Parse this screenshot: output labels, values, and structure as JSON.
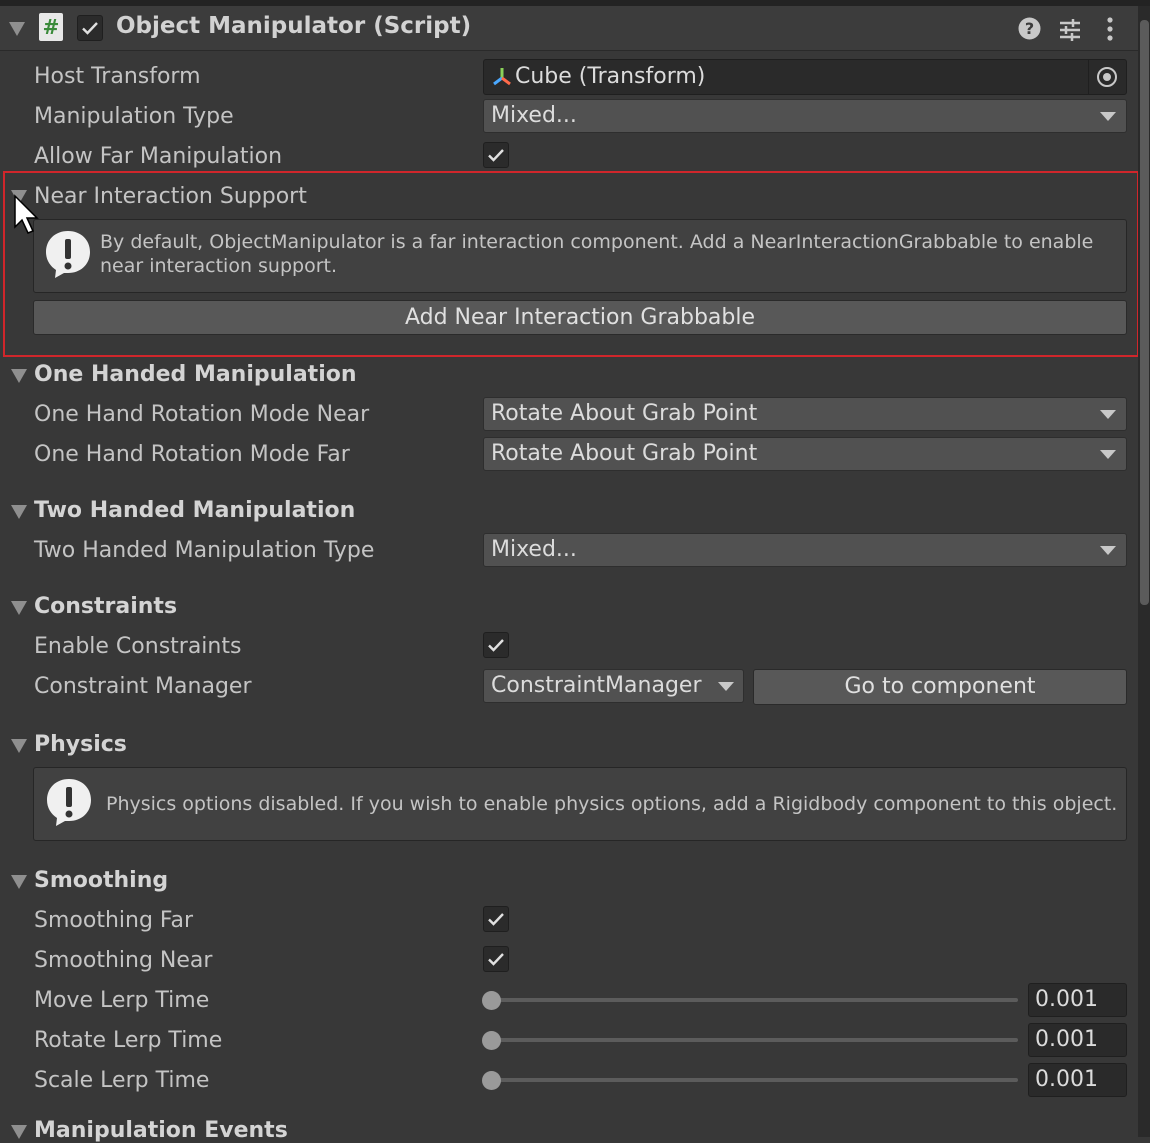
{
  "header": {
    "title": "Object Manipulator (Script)",
    "script_icon_glyph": "#",
    "icons": [
      "help-icon",
      "presets-icon",
      "kebab-menu-icon"
    ]
  },
  "fields": {
    "host_transform": {
      "label": "Host Transform",
      "value": "Cube (Transform)"
    },
    "manipulation_type": {
      "label": "Manipulation Type",
      "value": "Mixed..."
    },
    "allow_far": {
      "label": "Allow Far Manipulation",
      "checked": true
    }
  },
  "near": {
    "title": "Near Interaction Support",
    "help_line1": "By default, ObjectManipulator is a far interaction component.  Add a NearInteractionGrabbable to enable",
    "help_line2": "near interaction support.",
    "button": "Add Near Interaction Grabbable"
  },
  "one_handed": {
    "title": "One Handed Manipulation",
    "near_label": "One Hand Rotation Mode Near",
    "near_value": "Rotate About Grab Point",
    "far_label": "One Hand Rotation Mode Far",
    "far_value": "Rotate About Grab Point"
  },
  "two_handed": {
    "title": "Two Handed Manipulation",
    "type_label": "Two Handed Manipulation Type",
    "type_value": "Mixed..."
  },
  "constraints": {
    "title": "Constraints",
    "enable_label": "Enable Constraints",
    "enable_checked": true,
    "manager_label": "Constraint Manager",
    "manager_value": "ConstraintManager",
    "goto_button": "Go to component"
  },
  "physics": {
    "title": "Physics",
    "help": "Physics options disabled. If you wish to enable physics options, add a Rigidbody component to this object."
  },
  "smoothing": {
    "title": "Smoothing",
    "far_label": "Smoothing Far",
    "far_checked": true,
    "near_label": "Smoothing Near",
    "near_checked": true,
    "move_label": "Move Lerp Time",
    "move_value": "0.001",
    "rotate_label": "Rotate Lerp Time",
    "rotate_value": "0.001",
    "scale_label": "Scale Lerp Time",
    "scale_value": "0.001"
  },
  "events": {
    "title": "Manipulation Events"
  },
  "colors": {
    "background": "#383838",
    "highlight": "#d0262b",
    "field": "#515151"
  }
}
